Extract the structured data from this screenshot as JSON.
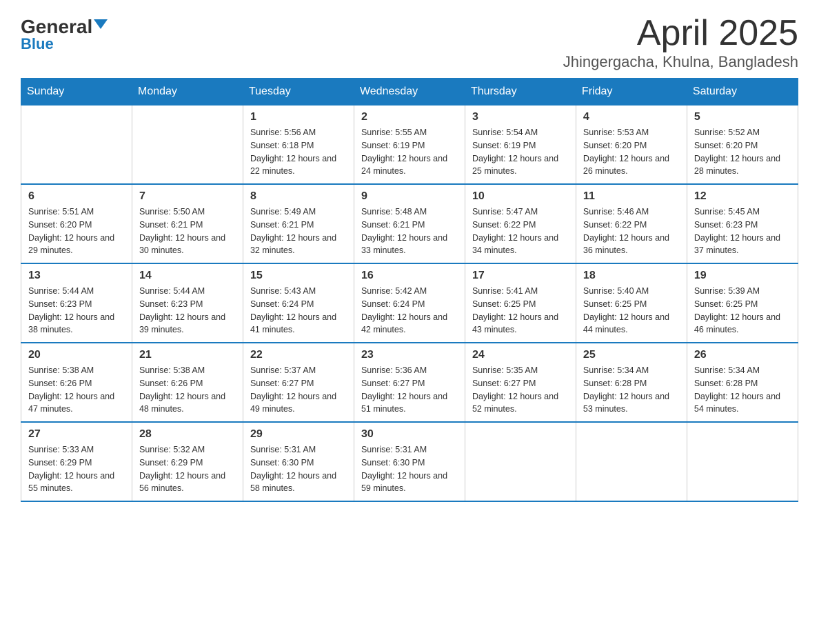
{
  "logo": {
    "general": "General",
    "blue": "Blue"
  },
  "title": "April 2025",
  "subtitle": "Jhingergacha, Khulna, Bangladesh",
  "weekdays": [
    "Sunday",
    "Monday",
    "Tuesday",
    "Wednesday",
    "Thursday",
    "Friday",
    "Saturday"
  ],
  "weeks": [
    [
      {
        "day": "",
        "info": ""
      },
      {
        "day": "",
        "info": ""
      },
      {
        "day": "1",
        "info": "Sunrise: 5:56 AM\nSunset: 6:18 PM\nDaylight: 12 hours\nand 22 minutes."
      },
      {
        "day": "2",
        "info": "Sunrise: 5:55 AM\nSunset: 6:19 PM\nDaylight: 12 hours\nand 24 minutes."
      },
      {
        "day": "3",
        "info": "Sunrise: 5:54 AM\nSunset: 6:19 PM\nDaylight: 12 hours\nand 25 minutes."
      },
      {
        "day": "4",
        "info": "Sunrise: 5:53 AM\nSunset: 6:20 PM\nDaylight: 12 hours\nand 26 minutes."
      },
      {
        "day": "5",
        "info": "Sunrise: 5:52 AM\nSunset: 6:20 PM\nDaylight: 12 hours\nand 28 minutes."
      }
    ],
    [
      {
        "day": "6",
        "info": "Sunrise: 5:51 AM\nSunset: 6:20 PM\nDaylight: 12 hours\nand 29 minutes."
      },
      {
        "day": "7",
        "info": "Sunrise: 5:50 AM\nSunset: 6:21 PM\nDaylight: 12 hours\nand 30 minutes."
      },
      {
        "day": "8",
        "info": "Sunrise: 5:49 AM\nSunset: 6:21 PM\nDaylight: 12 hours\nand 32 minutes."
      },
      {
        "day": "9",
        "info": "Sunrise: 5:48 AM\nSunset: 6:21 PM\nDaylight: 12 hours\nand 33 minutes."
      },
      {
        "day": "10",
        "info": "Sunrise: 5:47 AM\nSunset: 6:22 PM\nDaylight: 12 hours\nand 34 minutes."
      },
      {
        "day": "11",
        "info": "Sunrise: 5:46 AM\nSunset: 6:22 PM\nDaylight: 12 hours\nand 36 minutes."
      },
      {
        "day": "12",
        "info": "Sunrise: 5:45 AM\nSunset: 6:23 PM\nDaylight: 12 hours\nand 37 minutes."
      }
    ],
    [
      {
        "day": "13",
        "info": "Sunrise: 5:44 AM\nSunset: 6:23 PM\nDaylight: 12 hours\nand 38 minutes."
      },
      {
        "day": "14",
        "info": "Sunrise: 5:44 AM\nSunset: 6:23 PM\nDaylight: 12 hours\nand 39 minutes."
      },
      {
        "day": "15",
        "info": "Sunrise: 5:43 AM\nSunset: 6:24 PM\nDaylight: 12 hours\nand 41 minutes."
      },
      {
        "day": "16",
        "info": "Sunrise: 5:42 AM\nSunset: 6:24 PM\nDaylight: 12 hours\nand 42 minutes."
      },
      {
        "day": "17",
        "info": "Sunrise: 5:41 AM\nSunset: 6:25 PM\nDaylight: 12 hours\nand 43 minutes."
      },
      {
        "day": "18",
        "info": "Sunrise: 5:40 AM\nSunset: 6:25 PM\nDaylight: 12 hours\nand 44 minutes."
      },
      {
        "day": "19",
        "info": "Sunrise: 5:39 AM\nSunset: 6:25 PM\nDaylight: 12 hours\nand 46 minutes."
      }
    ],
    [
      {
        "day": "20",
        "info": "Sunrise: 5:38 AM\nSunset: 6:26 PM\nDaylight: 12 hours\nand 47 minutes."
      },
      {
        "day": "21",
        "info": "Sunrise: 5:38 AM\nSunset: 6:26 PM\nDaylight: 12 hours\nand 48 minutes."
      },
      {
        "day": "22",
        "info": "Sunrise: 5:37 AM\nSunset: 6:27 PM\nDaylight: 12 hours\nand 49 minutes."
      },
      {
        "day": "23",
        "info": "Sunrise: 5:36 AM\nSunset: 6:27 PM\nDaylight: 12 hours\nand 51 minutes."
      },
      {
        "day": "24",
        "info": "Sunrise: 5:35 AM\nSunset: 6:27 PM\nDaylight: 12 hours\nand 52 minutes."
      },
      {
        "day": "25",
        "info": "Sunrise: 5:34 AM\nSunset: 6:28 PM\nDaylight: 12 hours\nand 53 minutes."
      },
      {
        "day": "26",
        "info": "Sunrise: 5:34 AM\nSunset: 6:28 PM\nDaylight: 12 hours\nand 54 minutes."
      }
    ],
    [
      {
        "day": "27",
        "info": "Sunrise: 5:33 AM\nSunset: 6:29 PM\nDaylight: 12 hours\nand 55 minutes."
      },
      {
        "day": "28",
        "info": "Sunrise: 5:32 AM\nSunset: 6:29 PM\nDaylight: 12 hours\nand 56 minutes."
      },
      {
        "day": "29",
        "info": "Sunrise: 5:31 AM\nSunset: 6:30 PM\nDaylight: 12 hours\nand 58 minutes."
      },
      {
        "day": "30",
        "info": "Sunrise: 5:31 AM\nSunset: 6:30 PM\nDaylight: 12 hours\nand 59 minutes."
      },
      {
        "day": "",
        "info": ""
      },
      {
        "day": "",
        "info": ""
      },
      {
        "day": "",
        "info": ""
      }
    ]
  ]
}
